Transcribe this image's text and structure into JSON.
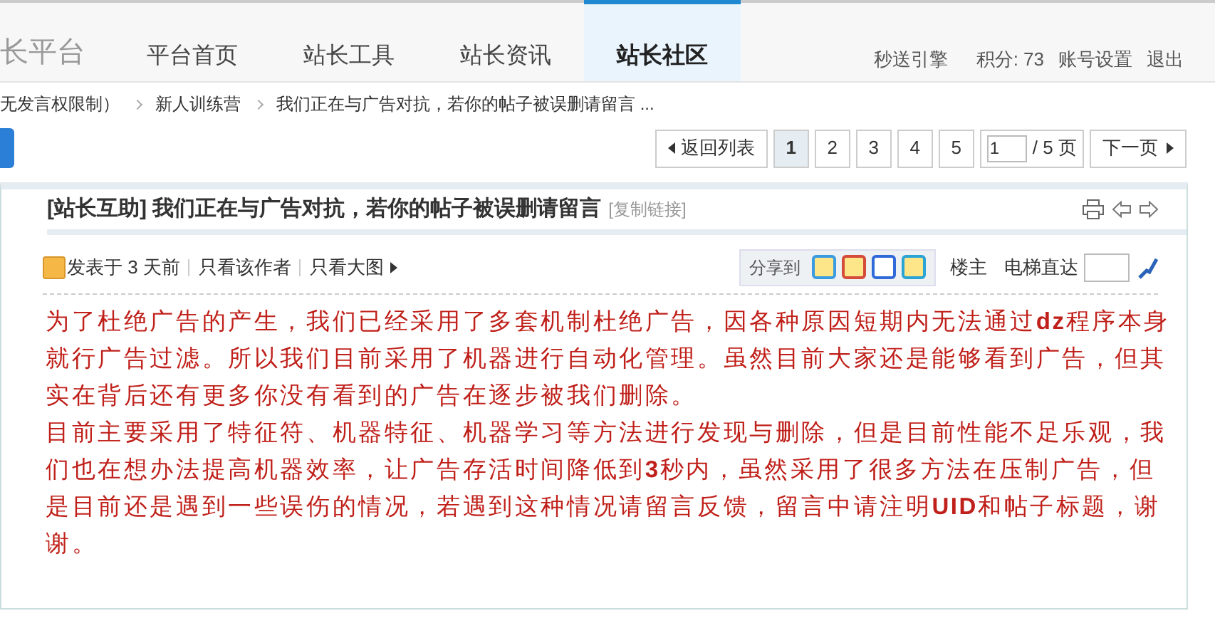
{
  "header": {
    "logo": "长平台",
    "nav": [
      {
        "label": "平台首页",
        "selected": false
      },
      {
        "label": "站长工具",
        "selected": false
      },
      {
        "label": "站长资讯",
        "selected": false
      },
      {
        "label": "站长社区",
        "selected": true
      }
    ],
    "links": [
      "秒送引擎",
      "积分: 73",
      "账号设置",
      "退出"
    ]
  },
  "breadcrumb": [
    "无发言权限制）",
    "新人训练营",
    "我们正在与广告对抗，若你的帖子被误删请留言 ..."
  ],
  "pagination": {
    "back": "返回列表",
    "pages": [
      {
        "label": "1",
        "selected": true
      },
      {
        "label": "2",
        "selected": false
      },
      {
        "label": "3",
        "selected": false
      },
      {
        "label": "4",
        "selected": false
      },
      {
        "label": "5",
        "selected": false
      }
    ],
    "page_input": "1",
    "total": "/ 5 页",
    "next": "下一页"
  },
  "thread": {
    "title": "[站长互助] 我们正在与广告对抗，若你的帖子被误删请留言",
    "copy_link": "[复制链接]",
    "posted": "发表于 3 天前",
    "only_author": "只看该作者",
    "only_images": "只看大图",
    "share_label": "分享到",
    "floor": "楼主",
    "jump_label": "电梯直达",
    "paragraphs": [
      "为了杜绝广告的产生，我们已经采用了多套机制杜绝广告，因各种原因短期内无法通过**dz**程序本身就行广告过滤。所以我们目前采用了机器进行自动化管理。虽然目前大家还是能够看到广告，但其实在背后还有更多你没有看到的广告在逐步被我们删除。",
      "目前主要采用了特征符、机器特征、机器学习等方法进行发现与删除，但是目前性能不足乐观，我们也在想办法提高机器效率，让广告存活时间降低到**3**秒内，虽然采用了很多方法在压制广告，但是目前还是遇到一些误伤的情况，若遇到这种情况请留言反馈，留言中请注明**UID**和帖子标题，谢谢。"
    ]
  }
}
